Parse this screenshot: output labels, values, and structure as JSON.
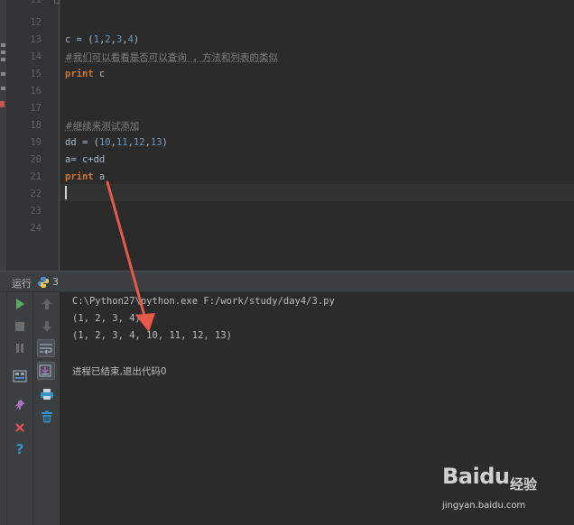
{
  "editor": {
    "line_numbers": [
      "12",
      "13",
      "14",
      "15",
      "16",
      "17",
      "18",
      "19",
      "20",
      "21",
      "22",
      "23",
      "24"
    ],
    "lines": {
      "l13": {
        "var": "c = ",
        "open": "(",
        "n1": "1",
        "n2": "2",
        "n3": "3",
        "n4": "4",
        "close": ")",
        "sep": ","
      },
      "l14": {
        "text": "#我们可以看看是否可以查询  ，方法和列表的类似"
      },
      "l15": {
        "kw": "print",
        "rest": " c"
      },
      "l18": {
        "text": "#继续来测试添加"
      },
      "l19": {
        "var": "dd = ",
        "open": "(",
        "n1": "10",
        "n2": "11",
        "n3": "12",
        "n4": "13",
        "close": ")",
        "sep": ","
      },
      "l20": {
        "text": "a= c+dd"
      },
      "l21": {
        "kw": "print",
        "rest": " a"
      }
    }
  },
  "run_panel": {
    "label": "运行",
    "tab_name": "3",
    "console": [
      "C:\\Python27\\python.exe F:/work/study/day4/3.py",
      "(1, 2, 3, 4)",
      "(1, 2, 3, 4, 10, 11, 12, 13)",
      "",
      "进程已结束,退出代码0"
    ],
    "toolbar_icons": [
      "run-icon",
      "stop-icon",
      "pause-icon",
      "layout-icon",
      "pin-icon",
      "close-icon",
      "help-icon",
      "up-arrow-icon",
      "down-arrow-icon",
      "soft-wrap-icon",
      "scroll-to-end-icon",
      "print-icon",
      "trash-icon"
    ]
  },
  "colors": {
    "keyword": "#cc7832",
    "number": "#6897bb",
    "comment": "#808080",
    "annotation_arrow": "#e8594a"
  },
  "watermark": {
    "brand": "Baidu",
    "cn": "经验",
    "url": "jingyan.baidu.com"
  }
}
